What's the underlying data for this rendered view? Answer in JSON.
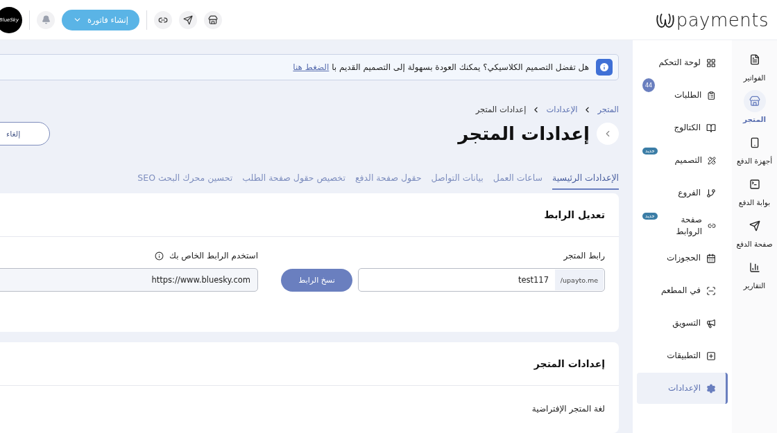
{
  "header": {
    "logo_text": "payments",
    "create_button": "إنشاء فاتورة",
    "avatar_text": "BlueSky"
  },
  "rail": [
    {
      "label": "الفواتير",
      "selected": false
    },
    {
      "label": "المتجر",
      "selected": true
    },
    {
      "label": "أجهزة الدفع",
      "selected": false
    },
    {
      "label": "بوابة الدفع",
      "selected": false
    },
    {
      "label": "صفحة الدفع",
      "selected": false
    },
    {
      "label": "التقارير",
      "selected": false
    }
  ],
  "nav": [
    {
      "label": "لوحة التحكم",
      "selected": false
    },
    {
      "label": "الطلبات",
      "selected": false,
      "badge": "44",
      "kind": "count"
    },
    {
      "label": "الكتالوج",
      "selected": false
    },
    {
      "label": "التصميم",
      "selected": false,
      "badge": "جديد",
      "kind": "new"
    },
    {
      "label": "الفروع",
      "selected": false
    },
    {
      "label": "صفحة الروابط",
      "selected": false,
      "badge": "جديد",
      "kind": "new"
    },
    {
      "label": "الحجوزات",
      "selected": false
    },
    {
      "label": "في المطعم",
      "selected": false
    },
    {
      "label": "التسويق",
      "selected": false
    },
    {
      "label": "التطبيقات",
      "selected": false
    },
    {
      "label": "الإعدادات",
      "selected": true
    }
  ],
  "banner": {
    "text": "هل تفضل التصميم الكلاسيكي؟ يمكنك العودة بسهولة إلى التصميم القديم با",
    "link": "الضغط هنا"
  },
  "breadcrumb": [
    {
      "label": "المتجر",
      "current": false
    },
    {
      "label": "الإعدادات",
      "current": false
    },
    {
      "label": "إعدادات المتجر",
      "current": true
    }
  ],
  "title": "إعدادات المتجر",
  "cancel_button": "إلغاء",
  "tabs": [
    {
      "label": "الإعدادات الرئيسية",
      "selected": true
    },
    {
      "label": "ساعات العمل",
      "selected": false
    },
    {
      "label": "بيانات التواصل",
      "selected": false
    },
    {
      "label": "حقول صفحة الدفع",
      "selected": false
    },
    {
      "label": "تخصيص حقول صفحة الطلب",
      "selected": false
    },
    {
      "label": "تحسين محرك البحث SEO",
      "selected": false
    }
  ],
  "link_card": {
    "title": "تعديل الرابط",
    "store_link_label": "رابط المتجر",
    "store_link_prefix": "/upayto.me",
    "store_link_value": "test117",
    "copy_button": "نسخ الرابط",
    "custom_link_label": "استخدم الرابط الخاص بك",
    "custom_link_value": "https://www.bluesky.com"
  },
  "store_card": {
    "title": "إعدادات المتجر",
    "language_label": "لغة المتجر الإفتراضية"
  }
}
